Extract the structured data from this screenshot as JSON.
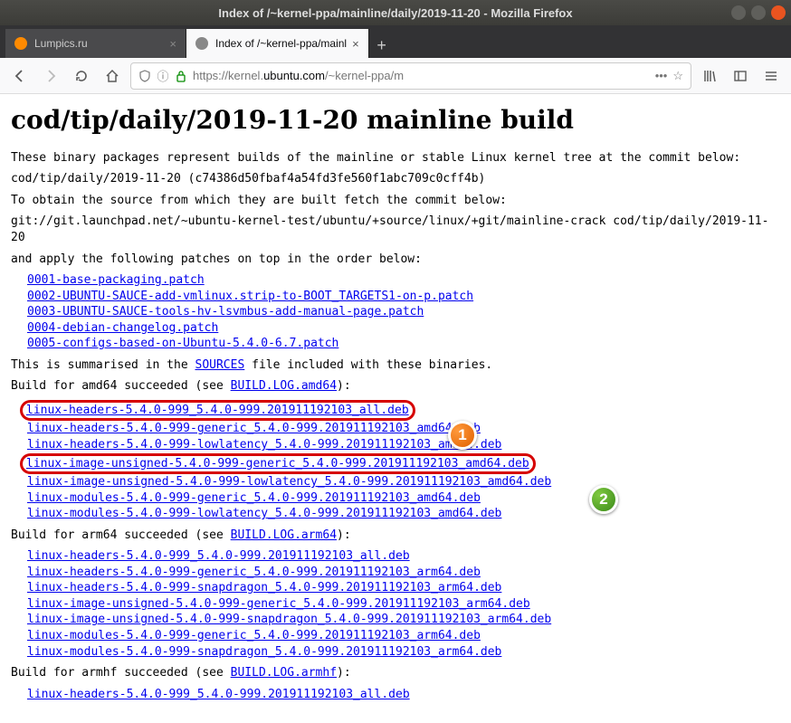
{
  "window": {
    "title": "Index of /~kernel-ppa/mainline/daily/2019-11-20 - Mozilla Firefox"
  },
  "tabs": [
    {
      "label": "Lumpics.ru",
      "active": false
    },
    {
      "label": "Index of /~kernel-ppa/mainl",
      "active": true
    }
  ],
  "url": {
    "scheme": "https://",
    "sub": "kernel.",
    "host": "ubuntu.com",
    "path": "/~kernel-ppa/m"
  },
  "page": {
    "heading": "cod/tip/daily/2019-11-20 mainline build",
    "intro": "These binary packages represent builds of the mainline or stable Linux kernel tree at the commit below:",
    "commit": "cod/tip/daily/2019-11-20 (c74386d50fbaf4a54fd3fe560f1abc709c0cff4b)",
    "source_line": "To obtain the source from which they are built fetch the commit below:",
    "git_line": "git://git.launchpad.net/~ubuntu-kernel-test/ubuntu/+source/linux/+git/mainline-crack cod/tip/daily/2019-11-20",
    "patches_line": "and apply the following patches on top in the order below:",
    "patches": [
      "0001-base-packaging.patch",
      "0002-UBUNTU-SAUCE-add-vmlinux.strip-to-BOOT_TARGETS1-on-p.patch",
      "0003-UBUNTU-SAUCE-tools-hv-lsvmbus-add-manual-page.patch",
      "0004-debian-changelog.patch",
      "0005-configs-based-on-Ubuntu-5.4.0-6.7.patch"
    ],
    "summary_pre": "This is summarised in the ",
    "summary_link": "SOURCES",
    "summary_post": " file included with these binaries.",
    "amd64_pre": "Build for amd64 succeeded (see ",
    "amd64_log": "BUILD.LOG.amd64",
    "amd64_post": "):",
    "amd64_files": [
      "linux-headers-5.4.0-999_5.4.0-999.201911192103_all.deb",
      "linux-headers-5.4.0-999-generic_5.4.0-999.201911192103_amd64.deb",
      "linux-headers-5.4.0-999-lowlatency_5.4.0-999.201911192103_amd64.deb",
      "linux-image-unsigned-5.4.0-999-generic_5.4.0-999.201911192103_amd64.deb",
      "linux-image-unsigned-5.4.0-999-lowlatency_5.4.0-999.201911192103_amd64.deb",
      "linux-modules-5.4.0-999-generic_5.4.0-999.201911192103_amd64.deb",
      "linux-modules-5.4.0-999-lowlatency_5.4.0-999.201911192103_amd64.deb"
    ],
    "arm64_pre": "Build for arm64 succeeded (see ",
    "arm64_log": "BUILD.LOG.arm64",
    "arm64_post": "):",
    "arm64_files": [
      "linux-headers-5.4.0-999_5.4.0-999.201911192103_all.deb",
      "linux-headers-5.4.0-999-generic_5.4.0-999.201911192103_arm64.deb",
      "linux-headers-5.4.0-999-snapdragon_5.4.0-999.201911192103_arm64.deb",
      "linux-image-unsigned-5.4.0-999-generic_5.4.0-999.201911192103_arm64.deb",
      "linux-image-unsigned-5.4.0-999-snapdragon_5.4.0-999.201911192103_arm64.deb",
      "linux-modules-5.4.0-999-generic_5.4.0-999.201911192103_arm64.deb",
      "linux-modules-5.4.0-999-snapdragon_5.4.0-999.201911192103_arm64.deb"
    ],
    "armhf_pre": "Build for armhf succeeded (see ",
    "armhf_log": "BUILD.LOG.armhf",
    "armhf_post": "):",
    "armhf_files": [
      "linux-headers-5.4.0-999_5.4.0-999.201911192103_all.deb"
    ]
  },
  "badges": {
    "one": "1",
    "two": "2"
  }
}
